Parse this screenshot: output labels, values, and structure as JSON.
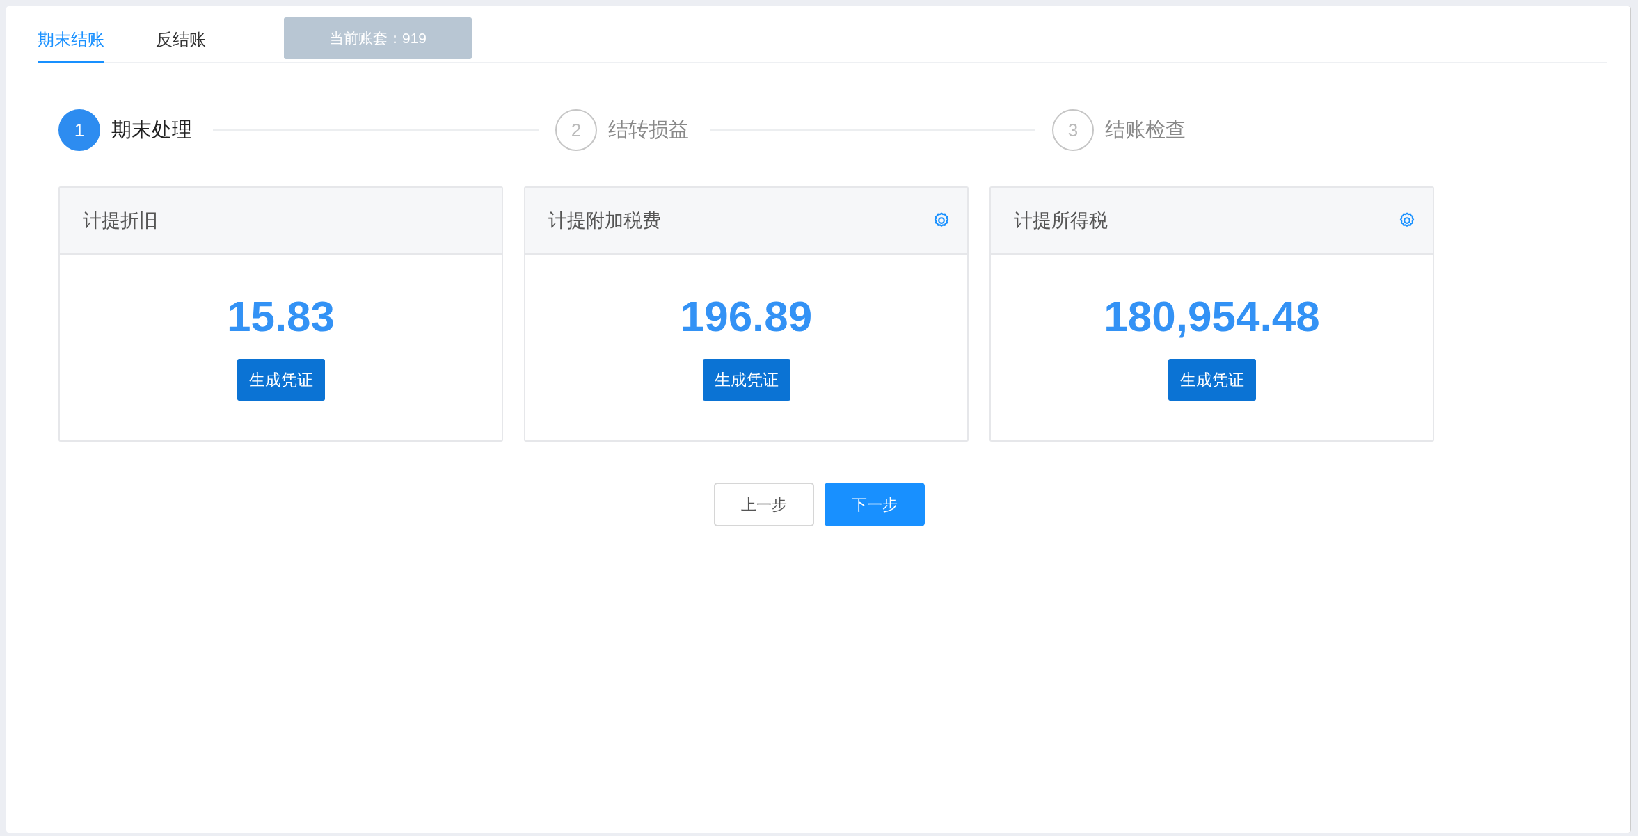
{
  "tabs": [
    {
      "label": "期末结账",
      "selected": true
    },
    {
      "label": "反结账",
      "selected": false
    }
  ],
  "account_badge": "当前账套：919",
  "steps": [
    {
      "number": "1",
      "label": "期末处理",
      "selected": true
    },
    {
      "number": "2",
      "label": "结转损益",
      "selected": false
    },
    {
      "number": "3",
      "label": "结账检查",
      "selected": false
    }
  ],
  "cards": [
    {
      "title": "计提折旧",
      "settings": false,
      "amount": "15.83",
      "button": "生成凭证"
    },
    {
      "title": "计提附加税费",
      "settings": true,
      "amount": "196.89",
      "button": "生成凭证"
    },
    {
      "title": "计提所得税",
      "settings": true,
      "amount": "180,954.48",
      "button": "生成凭证"
    }
  ],
  "buttons": [
    {
      "label": "上一步",
      "kind": "default"
    },
    {
      "label": "下一步",
      "kind": "primary"
    }
  ]
}
